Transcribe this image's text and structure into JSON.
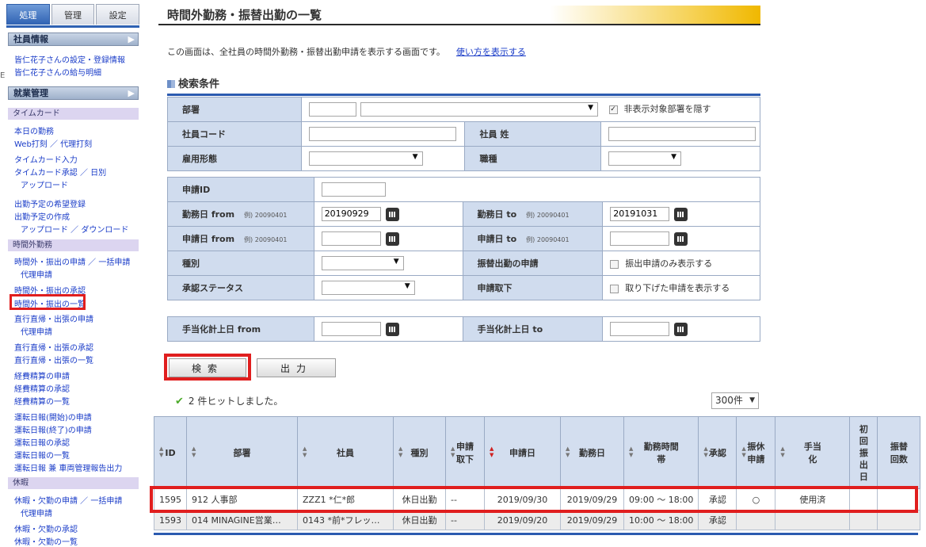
{
  "sidebar": {
    "edge_mark": "E",
    "tabs": [
      {
        "label": "処理",
        "active": true
      },
      {
        "label": "管理",
        "active": false
      },
      {
        "label": "設定",
        "active": false
      }
    ],
    "sections": {
      "employee_info": "社員情報",
      "work_mgmt": "就業管理",
      "timecard": "タイムカード",
      "overtime": "時間外勤務",
      "leave": "休暇"
    },
    "links": {
      "emp_settings": "皆仁花子さんの設定・登録情報",
      "emp_pay": "皆仁花子さんの給与明細",
      "today": "本日の勤務",
      "web_punch": "Web打刻 ／ 代理打刻",
      "tc_input": "タイムカード入力",
      "tc_approve": "タイムカード承認 ／ 日別",
      "upload": "アップロード",
      "plan_wish": "出勤予定の希望登録",
      "plan_make": "出勤予定の作成",
      "up_down": "アップロード ／ ダウンロード",
      "ot_apply": "時間外・振出の申請 ／ 一括申請",
      "ot_proxy": "代理申請",
      "ot_approve": "時間外・振出の承認",
      "ot_list": "時間外・振出の一覧",
      "direct_apply": "直行直帰・出張の申請",
      "direct_proxy": "代理申請",
      "direct_approve": "直行直帰・出張の承認",
      "direct_list": "直行直帰・出張の一覧",
      "exp_apply": "経費精算の申請",
      "exp_approve": "経費精算の承認",
      "exp_list": "経費精算の一覧",
      "drive_start": "運転日報(開始)の申請",
      "drive_end": "運転日報(終了)の申請",
      "drive_approve": "運転日報の承認",
      "drive_list": "運転日報の一覧",
      "drive_report": "運転日報 兼 車両管理報告出力",
      "leave_apply": "休暇・欠勤の申請 ／ 一括申請",
      "leave_proxy": "代理申請",
      "leave_approve": "休暇・欠勤の承認",
      "leave_list": "休暇・欠勤の一覧"
    }
  },
  "page": {
    "title": "時間外勤務・振替出勤の一覧",
    "description": "この画面は、全社員の時間外勤務・振替出勤申請を表示する画面です。",
    "help_link": "使い方を表示する",
    "criteria_title": "検索条件"
  },
  "form": {
    "dept_label": "部署",
    "hide_dept_label": "非表示対象部署を隠す",
    "hide_dept_checked": "✓",
    "emp_code_label": "社員コード",
    "emp_last_label": "社員 姓",
    "emp_type_label": "雇用形態",
    "job_label": "職種",
    "app_id_label": "申請ID",
    "work_from_label": "勤務日 from",
    "work_to_label": "勤務日 to",
    "example": "例) 20090401",
    "work_from_value": "20190929",
    "work_to_value": "20191031",
    "app_from_label": "申請日 from",
    "app_to_label": "申請日 to",
    "kind_label": "種別",
    "transfer_label": "振替出勤の申請",
    "transfer_only": "振出申請のみ表示する",
    "status_label": "承認ステータス",
    "withdraw_label": "申請取下",
    "withdraw_show": "取り下げた申請を表示する",
    "allow_from_label": "手当化計上日 from",
    "allow_to_label": "手当化計上日 to"
  },
  "buttons": {
    "search": "検索",
    "output": "出力"
  },
  "results": {
    "hits": "2 件ヒットしました。",
    "per_page": "300件",
    "columns": [
      "ID",
      "部署",
      "社員",
      "種別",
      "申請取下",
      "申請日",
      "勤務日",
      "勤務時間帯",
      "承認",
      "振休申請",
      "手当化",
      "初回振出日",
      "振替回数"
    ],
    "rows": [
      {
        "id": "1595",
        "dept": "912 人事部",
        "emp": "ZZZ1 *仁*郎",
        "kind": "休日出勤",
        "withdraw": "--",
        "app_date": "2019/09/30",
        "work_date": "2019/09/29",
        "hours": "09:00 ～ 18:00",
        "approval": "承認",
        "furikyu": "○",
        "allow": "使用済",
        "first": "",
        "count": ""
      },
      {
        "id": "1593",
        "dept": "014 MINAGINE営業…",
        "emp": "0143 *前*フレッ…",
        "kind": "休日出勤",
        "withdraw": "--",
        "app_date": "2019/09/20",
        "work_date": "2019/09/29",
        "hours": "10:00 ～ 18:00",
        "approval": "承認",
        "furikyu": "",
        "allow": "",
        "first": "",
        "count": ""
      }
    ]
  }
}
